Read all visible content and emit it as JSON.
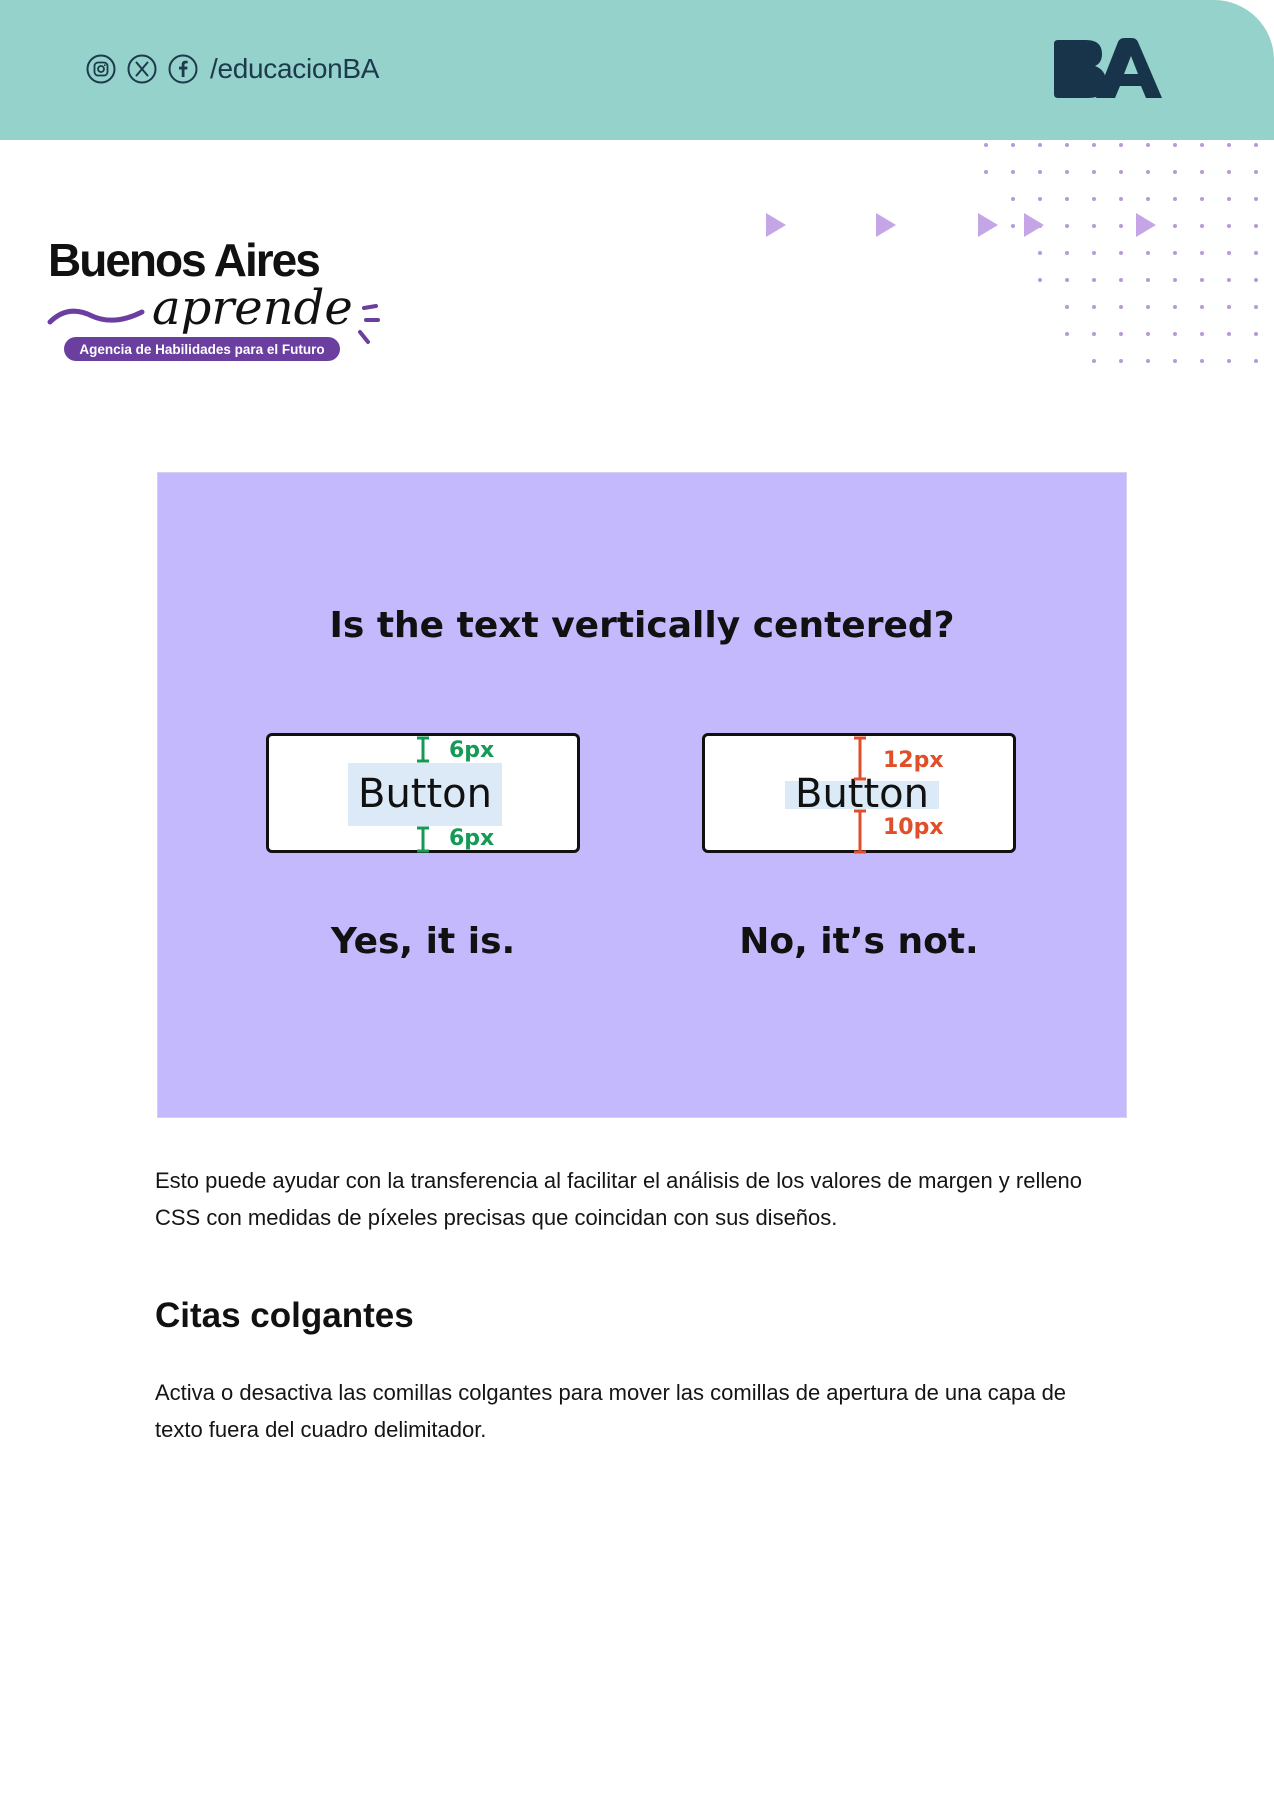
{
  "header": {
    "social_icons": [
      "instagram-icon",
      "x-icon",
      "facebook-icon"
    ],
    "social_handle": "/educacionBA",
    "logo_text": "BA",
    "band_color": "#95d2cc"
  },
  "brand": {
    "line1": "Buenos Aires",
    "line2": "aprende",
    "tagline": "Agencia de Habilidades para el Futuro",
    "accent_color": "#6a3fa0"
  },
  "figure": {
    "background": "#c4b9fd",
    "title": "Is the text vertically centered?",
    "examples": [
      {
        "button_label": "Button",
        "top_spacing": "6px",
        "bottom_spacing": "6px",
        "answer": "Yes, it is.",
        "status_color": "#149a55"
      },
      {
        "button_label": "Button",
        "top_spacing": "12px",
        "bottom_spacing": "10px",
        "answer": "No, it’s not.",
        "status_color": "#e04e2a"
      }
    ]
  },
  "content": {
    "paragraph1": "Esto puede ayudar con la transferencia al facilitar el análisis de los valores de margen y relleno CSS con medidas de píxeles precisas que coincidan con sus diseños.",
    "heading": "Citas colgantes",
    "paragraph2": "Activa o desactiva las comillas colgantes para mover las comillas de apertura de una capa de texto fuera del cuadro delimitador."
  }
}
